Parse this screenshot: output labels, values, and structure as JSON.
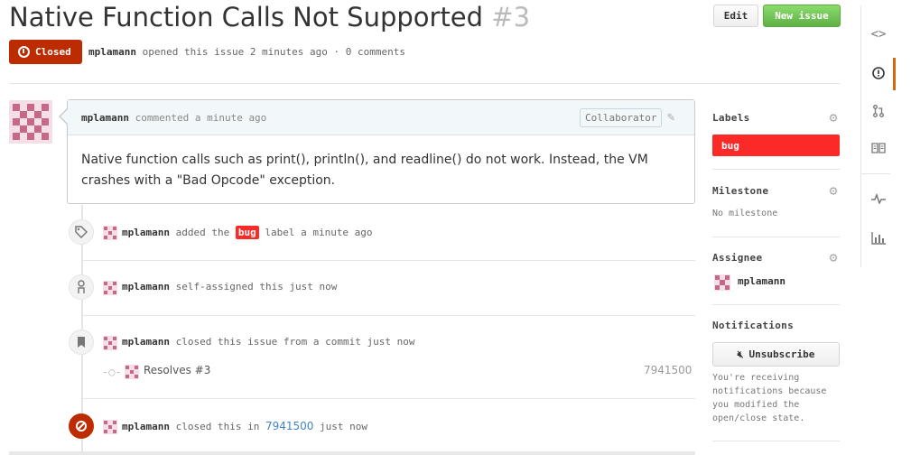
{
  "issue": {
    "title": "Native Function Calls Not Supported",
    "number": "#3",
    "state": "Closed",
    "author": "mplamann",
    "meta": "opened this issue 2 minutes ago · 0 comments"
  },
  "toolbar": {
    "edit_label": "Edit",
    "new_issue_label": "New issue"
  },
  "comment": {
    "author": "mplamann",
    "when": "commented a minute ago",
    "role": "Collaborator",
    "body": "Native function calls such as print(), println(), and readline() do not work. Instead, the VM crashes with a \"Bad Opcode\" exception."
  },
  "events": [
    {
      "icon": "tag-icon",
      "user": "mplamann",
      "pre": "added the",
      "label": "bug",
      "post": "label a minute ago"
    },
    {
      "icon": "person-icon",
      "user": "mplamann",
      "pre": "self-assigned this just now"
    },
    {
      "icon": "bookmark-icon",
      "user": "mplamann",
      "pre": "closed this issue from a commit just now"
    },
    {
      "icon": "closed-circle-icon",
      "user": "mplamann",
      "pre": "closed this in",
      "link": "7941500",
      "post": "just now"
    }
  ],
  "commit": {
    "message": "Resolves #3",
    "sha": "7941500"
  },
  "sidebar": {
    "labels_heading": "Labels",
    "label": "bug",
    "milestone_heading": "Milestone",
    "milestone_value": "No milestone",
    "assignee_heading": "Assignee",
    "assignee": "mplamann",
    "notifications_heading": "Notifications",
    "unsubscribe_label": "Unsubscribe",
    "notifications_text": "You're receiving notifications because you modified the open/close state."
  },
  "colors": {
    "closed": "#bd2c00",
    "bug": "#fc2929",
    "new_issue": "#60b044",
    "rail_active": "#d26911"
  },
  "rail": [
    "code-icon",
    "issue-icon",
    "pull-request-icon",
    "wiki-icon",
    "pulse-icon",
    "graphs-icon"
  ]
}
